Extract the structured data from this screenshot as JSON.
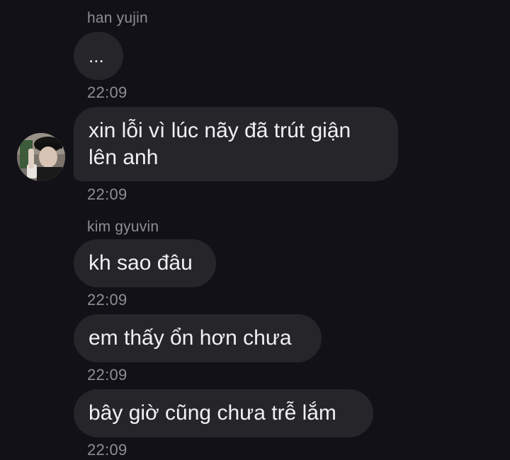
{
  "messages": [
    {
      "sender": "han yujin",
      "text": "...",
      "time": "22:09"
    },
    {
      "sender": "",
      "text": "xin lỗi vì lúc nãy đã trút giận\nlên anh",
      "time": "22:09"
    },
    {
      "sender": "kim gyuvin",
      "text": "kh sao đâu",
      "time": "22:09"
    },
    {
      "sender": "",
      "text": "em thấy ổn hơn chưa",
      "time": "22:09"
    },
    {
      "sender": "",
      "text": "bây giờ cũng chưa trễ lắm",
      "time": "22:09"
    }
  ],
  "avatar": {
    "icon": "user-avatar-photo"
  },
  "colors": {
    "background": "#131118",
    "bubble": "#262529",
    "text": "#f1f0f3",
    "meta": "#8f8c96"
  }
}
